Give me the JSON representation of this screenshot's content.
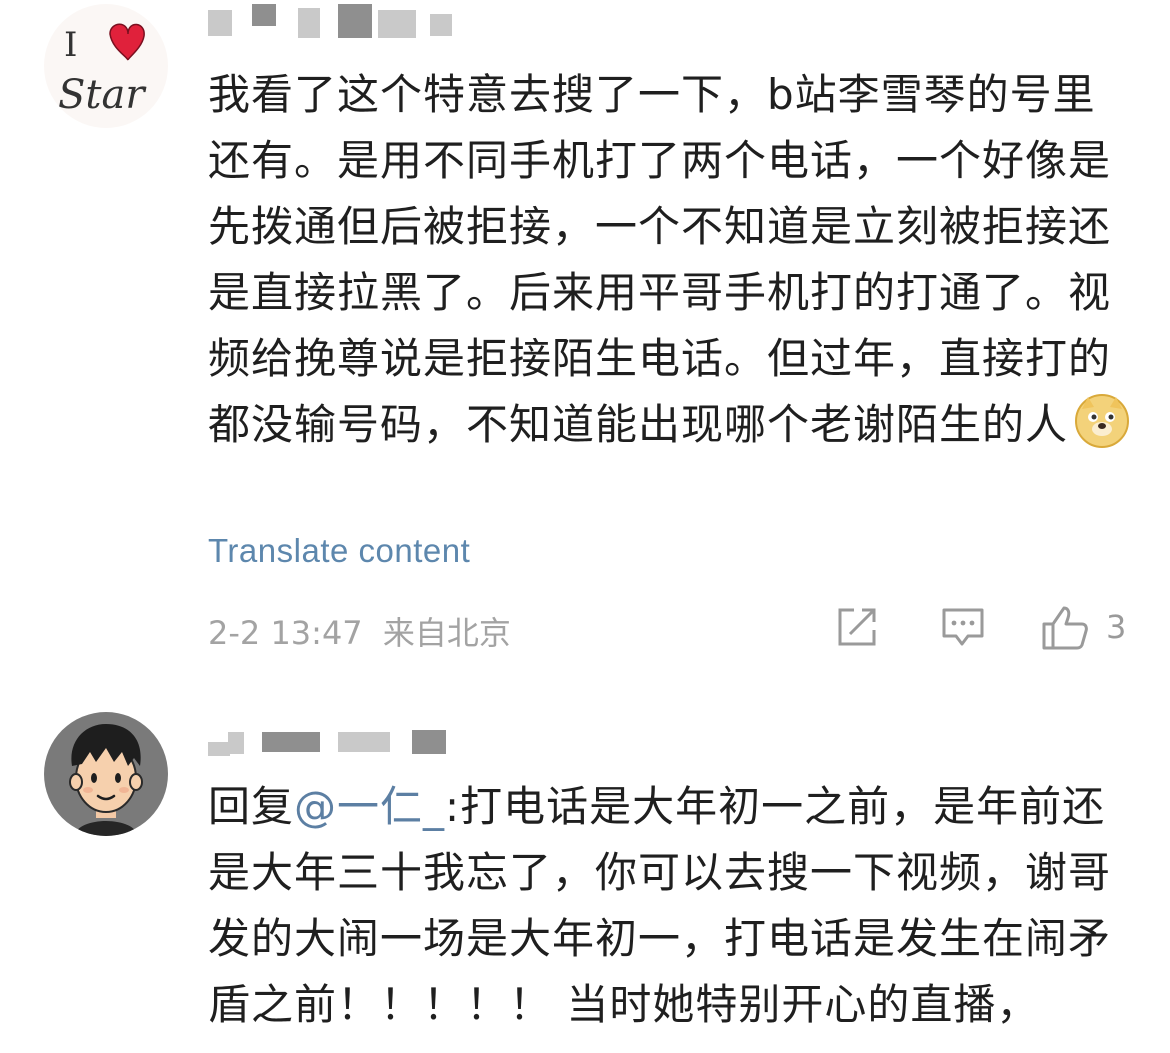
{
  "comments": [
    {
      "avatar": {
        "icon": "i-love-star-avatar-icon",
        "heart_color": "#e0213b",
        "text_line1": "I",
        "text_line2": "Star"
      },
      "body": "我看了这个特意去搜了一下，b站李雪琴的号里还有。是用不同手机打了两个电话，一个好像是先拨通但后被拒接，一个不知道是立刻被拒接还是直接拉黑了。后来用平哥手机打的打通了。视频给挽尊说是拒接陌生电话。但过年，直接打的都没输号码，不知道能出现哪个老谢陌生的人",
      "emoji": "doge-emoji-icon",
      "translate_label": "Translate content",
      "timestamp": "2-2 13:47",
      "location": "来自北京",
      "actions": {
        "share_icon": "share-icon",
        "comment_icon": "comment-icon",
        "like_icon": "thumbs-up-icon",
        "like_count": "3"
      }
    },
    {
      "avatar": {
        "icon": "cartoon-boy-avatar-icon",
        "bg_color": "#7a7a7a"
      },
      "reply_prefix": "回复",
      "mention": "@一仁_",
      "body": ":打电话是大年初一之前，是年前还是大年三十我忘了，你可以去搜一下视频，谢哥发的大闹一场是大年初一，打电话是发生在闹矛盾之前！！！！！ 当时她特别开心的直播，"
    }
  ],
  "colors": {
    "translate_link": "#5d87ad",
    "mention": "#5c7fa3",
    "meta_text": "#a3a3a3"
  }
}
